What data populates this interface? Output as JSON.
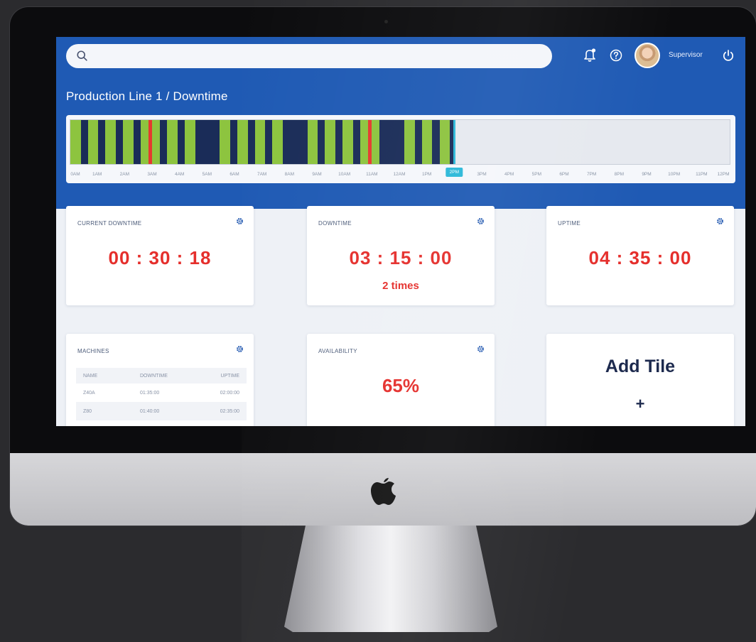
{
  "header": {
    "search_placeholder": "",
    "user_name": "Supervisor"
  },
  "breadcrumb": {
    "text": "Production Line 1  / Downtime"
  },
  "timeline": {
    "hours": [
      "0AM",
      "1AM",
      "2AM",
      "3AM",
      "4AM",
      "5AM",
      "6AM",
      "7AM",
      "8AM",
      "9AM",
      "10AM",
      "11AM",
      "12AM",
      "1PM",
      "2PM",
      "3PM",
      "4PM",
      "5PM",
      "6PM",
      "7PM",
      "8PM",
      "9PM",
      "10PM",
      "11PM",
      "12PM"
    ],
    "current_hour": "2PM",
    "current_index": 14,
    "segments": [
      {
        "state": "up",
        "len": 1.0
      },
      {
        "state": "down",
        "len": 0.7
      },
      {
        "state": "up",
        "len": 1.0
      },
      {
        "state": "down",
        "len": 0.7
      },
      {
        "state": "up",
        "len": 1.0
      },
      {
        "state": "down",
        "len": 0.7
      },
      {
        "state": "up",
        "len": 1.0
      },
      {
        "state": "down",
        "len": 0.7
      },
      {
        "state": "up",
        "len": 0.8
      },
      {
        "state": "alert",
        "len": 0.3
      },
      {
        "state": "up",
        "len": 0.8
      },
      {
        "state": "down",
        "len": 0.7
      },
      {
        "state": "up",
        "len": 1.0
      },
      {
        "state": "down",
        "len": 0.7
      },
      {
        "state": "up",
        "len": 1.0
      },
      {
        "state": "down",
        "len": 2.4
      },
      {
        "state": "up",
        "len": 1.0
      },
      {
        "state": "down",
        "len": 0.7
      },
      {
        "state": "up",
        "len": 1.0
      },
      {
        "state": "down",
        "len": 0.7
      },
      {
        "state": "up",
        "len": 1.0
      },
      {
        "state": "down",
        "len": 0.7
      },
      {
        "state": "up",
        "len": 1.0
      },
      {
        "state": "down",
        "len": 2.4
      },
      {
        "state": "up",
        "len": 1.0
      },
      {
        "state": "down",
        "len": 0.7
      },
      {
        "state": "up",
        "len": 1.0
      },
      {
        "state": "down",
        "len": 0.7
      },
      {
        "state": "up",
        "len": 1.0
      },
      {
        "state": "down",
        "len": 0.7
      },
      {
        "state": "up",
        "len": 0.8
      },
      {
        "state": "alert",
        "len": 0.3
      },
      {
        "state": "up",
        "len": 0.8
      },
      {
        "state": "down",
        "len": 2.4
      },
      {
        "state": "up",
        "len": 1.0
      },
      {
        "state": "down",
        "len": 0.7
      },
      {
        "state": "up",
        "len": 1.0
      },
      {
        "state": "down",
        "len": 0.7
      },
      {
        "state": "up",
        "len": 1.0
      },
      {
        "state": "down",
        "len": 0.5
      }
    ],
    "colors": {
      "up": "#8dc43f",
      "down": "#1a2c58",
      "alert": "#e43a2f",
      "marker": "#2bb8d8"
    }
  },
  "tiles": {
    "current_downtime": {
      "title": "CURRENT DOWNTIME",
      "value": "00 : 30 : 18"
    },
    "downtime": {
      "title": "DOWNTIME",
      "value": "03 : 15 : 00",
      "count": "2 times"
    },
    "uptime": {
      "title": "UPTIME",
      "value": "04 : 35 : 00"
    },
    "machines": {
      "title": "MACHINES",
      "columns": [
        "NAME",
        "DOWNTIME",
        "UPTIME"
      ],
      "rows": [
        [
          "Z40A",
          "01:35:00",
          "02:00:00"
        ],
        [
          "Z80",
          "01:40:00",
          "02:35:00"
        ]
      ]
    },
    "availability": {
      "title": "AVAILABILITY",
      "value": "65%"
    },
    "add_tile": {
      "label": "Add Tile",
      "plus": "+"
    }
  },
  "colors": {
    "header_blue": "#1f5ab4",
    "alert_red": "#e52f2c",
    "navy": "#1d2a4e"
  }
}
